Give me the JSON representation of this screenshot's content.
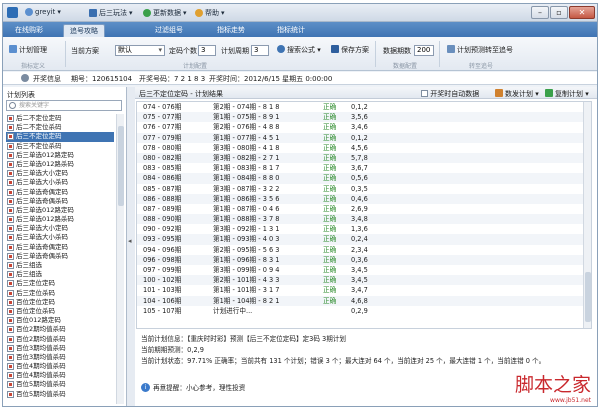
{
  "titlebar": {
    "user_label": "greyit",
    "menu_gameplay": "后三玩法",
    "menu_update": "更新数据",
    "menu_help": "帮助"
  },
  "tabs": [
    {
      "label": "在线购彩",
      "active": false
    },
    {
      "label": "追号攻略",
      "active": true
    },
    {
      "label": "过滤组号",
      "active": false
    },
    {
      "label": "指标走势",
      "active": false
    },
    {
      "label": "指标统计",
      "active": false
    }
  ],
  "ribbon": {
    "plan_manage": "计划管理",
    "current_plan_label": "当前方案",
    "current_plan_value": "默认",
    "code_count_label": "定码个数",
    "code_count_value": "3",
    "cycle_label": "计划周期",
    "cycle_value": "3",
    "search_formula": "搜索公式",
    "save_plan": "保存方案",
    "data_periods_label": "数据期数",
    "data_periods_value": "200",
    "predict_to_chase": "计划预测转至追号",
    "group_plan_def": "指标定义",
    "group_plan_setting": "计划配置",
    "group_data_config": "数据配置",
    "group_chase": "转至追号"
  },
  "infobar": {
    "label": "开奖信息",
    "issue": "期号：120615104",
    "numbers": "开奖号码：7 2 1 8 3",
    "time": "开奖时间：2012/6/15 星期五 0:00:00"
  },
  "left": {
    "title": "计划列表",
    "search_placeholder": "搜索关键字",
    "items": [
      {
        "label": "后二不定位定码",
        "red": true,
        "selected": false
      },
      {
        "label": "后二不定位杀码",
        "red": true,
        "selected": false
      },
      {
        "label": "后三不定位定码",
        "red": true,
        "selected": true
      },
      {
        "label": "后三不定位杀码",
        "red": true,
        "selected": false
      },
      {
        "label": "后三单选012路定码",
        "red": true,
        "selected": false
      },
      {
        "label": "后三单选012路杀码",
        "red": true,
        "selected": false
      },
      {
        "label": "后三单选大小定码",
        "red": true,
        "selected": false
      },
      {
        "label": "后三单选大小杀码",
        "red": true,
        "selected": false
      },
      {
        "label": "后三单选奇偶定码",
        "red": true,
        "selected": false
      },
      {
        "label": "后三单选奇偶杀码",
        "red": true,
        "selected": false
      },
      {
        "label": "后三单选012路定码",
        "red": true,
        "selected": false
      },
      {
        "label": "后三单选012路杀码",
        "red": true,
        "selected": false
      },
      {
        "label": "后三单选大小定码",
        "red": true,
        "selected": false
      },
      {
        "label": "后三单选大小杀码",
        "red": true,
        "selected": false
      },
      {
        "label": "后三单选奇偶定码",
        "red": true,
        "selected": false
      },
      {
        "label": "后三单选奇偶杀码",
        "red": true,
        "selected": false
      },
      {
        "label": "后三组选",
        "red": true,
        "selected": false
      },
      {
        "label": "后三组选",
        "red": true,
        "selected": false
      },
      {
        "label": "后三定位定码",
        "red": true,
        "selected": false
      },
      {
        "label": "后三定位杀码",
        "red": true,
        "selected": false
      },
      {
        "label": "百位定位定码",
        "red": true,
        "selected": false
      },
      {
        "label": "百位定位杀码",
        "red": true,
        "selected": false
      },
      {
        "label": "百位012路定码",
        "red": true,
        "selected": false
      },
      {
        "label": "百位2期均值杀码",
        "red": true,
        "selected": false
      },
      {
        "label": "百位2期均值杀码",
        "red": true,
        "selected": false
      },
      {
        "label": "百位3期均值杀码",
        "red": true,
        "selected": false
      },
      {
        "label": "百位3期均值杀码",
        "red": true,
        "selected": false
      },
      {
        "label": "百位4期均值杀码",
        "red": true,
        "selected": false
      },
      {
        "label": "百位4期均值杀码",
        "red": true,
        "selected": false
      },
      {
        "label": "百位5期均值杀码",
        "red": true,
        "selected": false
      },
      {
        "label": "百位5期均值杀码",
        "red": true,
        "selected": false
      }
    ]
  },
  "main": {
    "title": "后三不定位定码 - 计划结果",
    "auto_chase_label": "开奖时自动数据",
    "chase_plan": "数发计划",
    "copy_plan": "复制计划",
    "rows": [
      {
        "period": "074 - 076期",
        "plan": "第2期 - 074期 - 8 1 8",
        "result": "正确",
        "nums": "0,1,2"
      },
      {
        "period": "075 - 077期",
        "plan": "第1期 - 075期 - 8 9 1",
        "result": "正确",
        "nums": "3,5,6"
      },
      {
        "period": "076 - 077期",
        "plan": "第2期 - 076期 - 4 8 8",
        "result": "正确",
        "nums": "3,4,6"
      },
      {
        "period": "077 - 079期",
        "plan": "第1期 - 077期 - 4 5 1",
        "result": "正确",
        "nums": "0,1,2"
      },
      {
        "period": "078 - 080期",
        "plan": "第3期 - 080期 - 4 1 8",
        "result": "正确",
        "nums": "4,5,6"
      },
      {
        "period": "080 - 082期",
        "plan": "第3期 - 082期 - 2 7 1",
        "result": "正确",
        "nums": "5,7,8"
      },
      {
        "period": "083 - 085期",
        "plan": "第1期 - 083期 - 8 1 7",
        "result": "正确",
        "nums": "3,6,7"
      },
      {
        "period": "084 - 086期",
        "plan": "第1期 - 084期 - 8 8 0",
        "result": "正确",
        "nums": "0,5,6"
      },
      {
        "period": "085 - 087期",
        "plan": "第3期 - 087期 - 3 2 2",
        "result": "正确",
        "nums": "0,3,5"
      },
      {
        "period": "086 - 088期",
        "plan": "第1期 - 086期 - 3 5 6",
        "result": "正确",
        "nums": "0,4,6"
      },
      {
        "period": "087 - 089期",
        "plan": "第1期 - 087期 - 0 4 6",
        "result": "正确",
        "nums": "2,6,9"
      },
      {
        "period": "088 - 090期",
        "plan": "第1期 - 088期 - 3 7 8",
        "result": "正确",
        "nums": "3,4,8"
      },
      {
        "period": "090 - 092期",
        "plan": "第3期 - 092期 - 1 3 1",
        "result": "正确",
        "nums": "1,3,6"
      },
      {
        "period": "093 - 095期",
        "plan": "第1期 - 093期 - 4 0 3",
        "result": "正确",
        "nums": "0,2,4"
      },
      {
        "period": "094 - 096期",
        "plan": "第2期 - 095期 - 5 6 3",
        "result": "正确",
        "nums": "2,3,4"
      },
      {
        "period": "096 - 098期",
        "plan": "第1期 - 096期 - 8 3 1",
        "result": "正确",
        "nums": "0,3,6"
      },
      {
        "period": "097 - 099期",
        "plan": "第3期 - 099期 - 0 9 4",
        "result": "正确",
        "nums": "3,4,5"
      },
      {
        "period": "100 - 102期",
        "plan": "第2期 - 101期 - 4 3 3",
        "result": "正确",
        "nums": "3,4,5"
      },
      {
        "period": "101 - 103期",
        "plan": "第1期 - 101期 - 3 1 7",
        "result": "正确",
        "nums": "3,4,7"
      },
      {
        "period": "104 - 106期",
        "plan": "第1期 - 104期 - 8 2 1",
        "result": "正确",
        "nums": "4,6,8"
      },
      {
        "period": "105 - 107期",
        "plan": "计划进行中...",
        "result": "",
        "nums": "0,2,9"
      }
    ],
    "stats": [
      "当前计划信息：【重庆时时彩】预测【后三不定位定码】定3码 3期计划",
      "当前期期预测：0,2,9",
      "当前计划状态：97.71% 正确率；当前共有 131 个计划；错误 3 个；最大连对 64 个，当前连对 25 个，最大连错 1 个，当前连错 0 个。"
    ],
    "tip": "再意提醒：小心参考，理性投资"
  },
  "watermark": {
    "line1": "脚本之家",
    "line2": "www.jb51.net"
  }
}
